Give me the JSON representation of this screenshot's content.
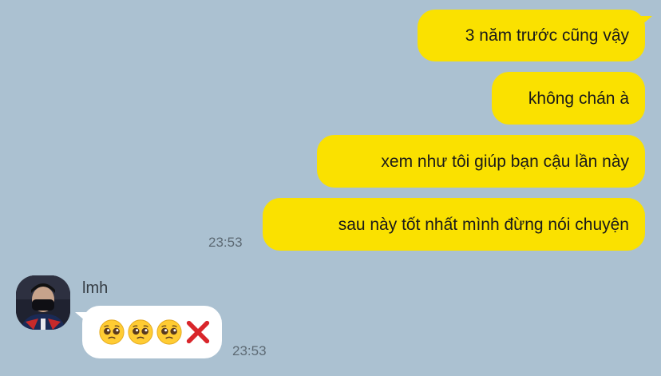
{
  "chat": {
    "sent_messages": [
      {
        "text": "3 năm trước cũng vậy"
      },
      {
        "text": "không chán à"
      },
      {
        "text": "xem như tôi giúp bạn cậu lần này"
      },
      {
        "text": "sau này tốt nhất mình đừng nói chuyện"
      }
    ],
    "sent_time": "23:53",
    "received": {
      "sender_name": "lmh",
      "emojis": [
        "pleading-face",
        "pleading-face",
        "pleading-face",
        "cross-mark"
      ],
      "time": "23:53"
    }
  },
  "colors": {
    "background": "#abc1d1",
    "sent_bubble": "#fae100",
    "received_bubble": "#ffffff",
    "cross_mark": "#d9262b"
  }
}
